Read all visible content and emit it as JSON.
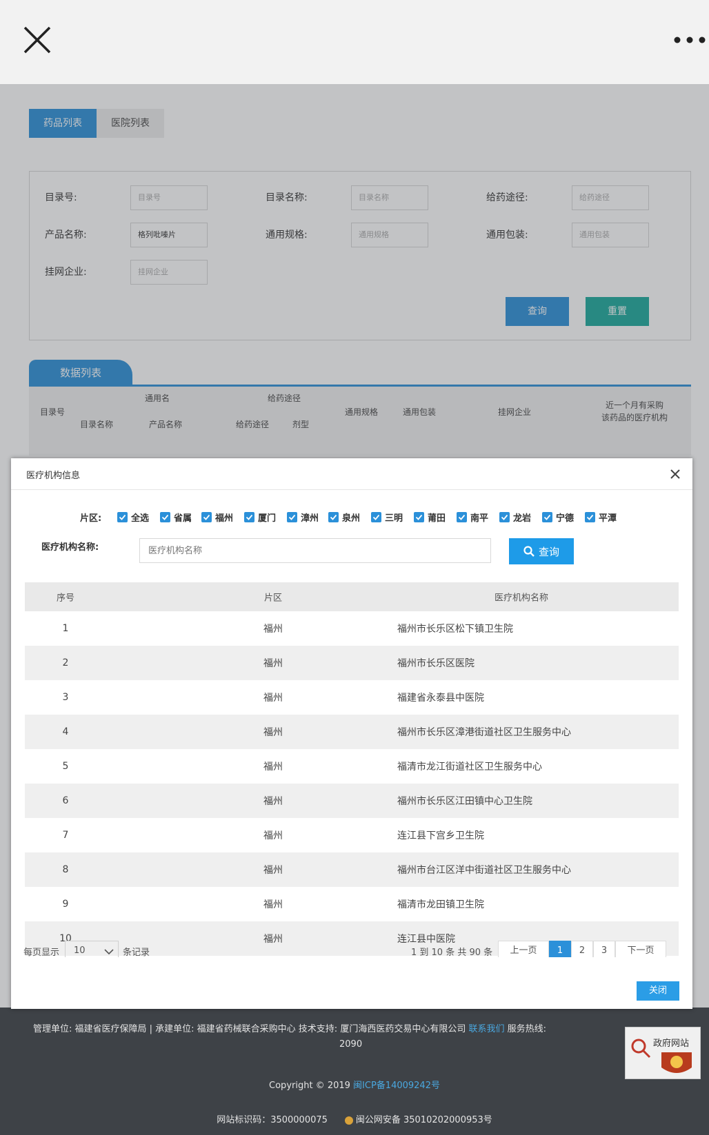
{
  "topbar": {
    "close_icon": "close-icon",
    "more_icon": "more-dots-icon"
  },
  "tabs": [
    {
      "label": "药品列表",
      "active": true
    },
    {
      "label": "医院列表",
      "active": false
    }
  ],
  "search": {
    "fields": [
      {
        "label": "目录号:",
        "placeholder": "目录号",
        "value": ""
      },
      {
        "label": "目录名称:",
        "placeholder": "目录名称",
        "value": ""
      },
      {
        "label": "给药途径:",
        "placeholder": "给药途径",
        "value": ""
      },
      {
        "label": "产品名称:",
        "placeholder": "产品名称",
        "value": "格列吡嗪片"
      },
      {
        "label": "通用规格:",
        "placeholder": "通用规格",
        "value": ""
      },
      {
        "label": "通用包装:",
        "placeholder": "通用包装",
        "value": ""
      },
      {
        "label": "挂网企业:",
        "placeholder": "挂网企业",
        "value": ""
      }
    ],
    "query_label": "查询",
    "reset_label": "重置"
  },
  "data_list": {
    "tab_label": "数据列表",
    "headers": {
      "catalog_no": "目录号",
      "generic_name": "通用名",
      "catalog_name": "目录名称",
      "product_name": "产品名称",
      "route_group": "给药途径",
      "route": "给药途径",
      "dosage_form": "剂型",
      "spec": "通用规格",
      "package": "通用包装",
      "company": "挂网企业",
      "recent_l1": "近一个月有采购",
      "recent_l2": "该药品的医疗机构"
    }
  },
  "modal": {
    "title": "医疗机构信息",
    "region_label": "片区:",
    "regions": [
      "全选",
      "省属",
      "福州",
      "厦门",
      "漳州",
      "泉州",
      "三明",
      "莆田",
      "南平",
      "龙岩",
      "宁德",
      "平潭"
    ],
    "name_label": "医疗机构名称:",
    "name_placeholder": "医疗机构名称",
    "query_label": "查询",
    "table": {
      "headers": [
        "序号",
        "片区",
        "医疗机构名称"
      ],
      "rows": [
        [
          "1",
          "福州",
          "福州市长乐区松下镇卫生院"
        ],
        [
          "2",
          "福州",
          "福州市长乐区医院"
        ],
        [
          "3",
          "福州",
          "福建省永泰县中医院"
        ],
        [
          "4",
          "福州",
          "福州市长乐区漳港街道社区卫生服务中心"
        ],
        [
          "5",
          "福州",
          "福清市龙江街道社区卫生服务中心"
        ],
        [
          "6",
          "福州",
          "福州市长乐区江田镇中心卫生院"
        ],
        [
          "7",
          "福州",
          "连江县下宫乡卫生院"
        ],
        [
          "8",
          "福州",
          "福州市台江区洋中街道社区卫生服务中心"
        ],
        [
          "9",
          "福州",
          "福清市龙田镇卫生院"
        ],
        [
          "10",
          "福州",
          "连江县中医院"
        ]
      ]
    },
    "pager": {
      "per_page_prefix": "每页显示",
      "per_page_value": "10",
      "per_page_suffix": "条记录",
      "info": "1 到 10 条 共 90 条",
      "prev": "上一页",
      "pages": [
        "1",
        "2",
        "3"
      ],
      "current_page": "1",
      "next": "下一页"
    },
    "close_label": "关闭"
  },
  "footer": {
    "line1": "管理单位: 福建省医疗保障局  |  承建单位: 福建省药械联合采购中心  技术支持: 厦门海西医药交易中心有限公司",
    "contact_link": "联系我们",
    "hotline_label": "服务热线:",
    "hotline_tail": "2090",
    "copyright": "Copyright © 2019",
    "icp": "闽ICP备14009242号",
    "site_id": "网站标识码：3500000075",
    "police": "闽公网安备 35010202000953号",
    "gov_badge": "政府网站"
  },
  "colors": {
    "primary": "#2b90d9",
    "teal": "#1aa99b",
    "footer_bg": "#3e4247",
    "link": "#4aa8e0"
  }
}
